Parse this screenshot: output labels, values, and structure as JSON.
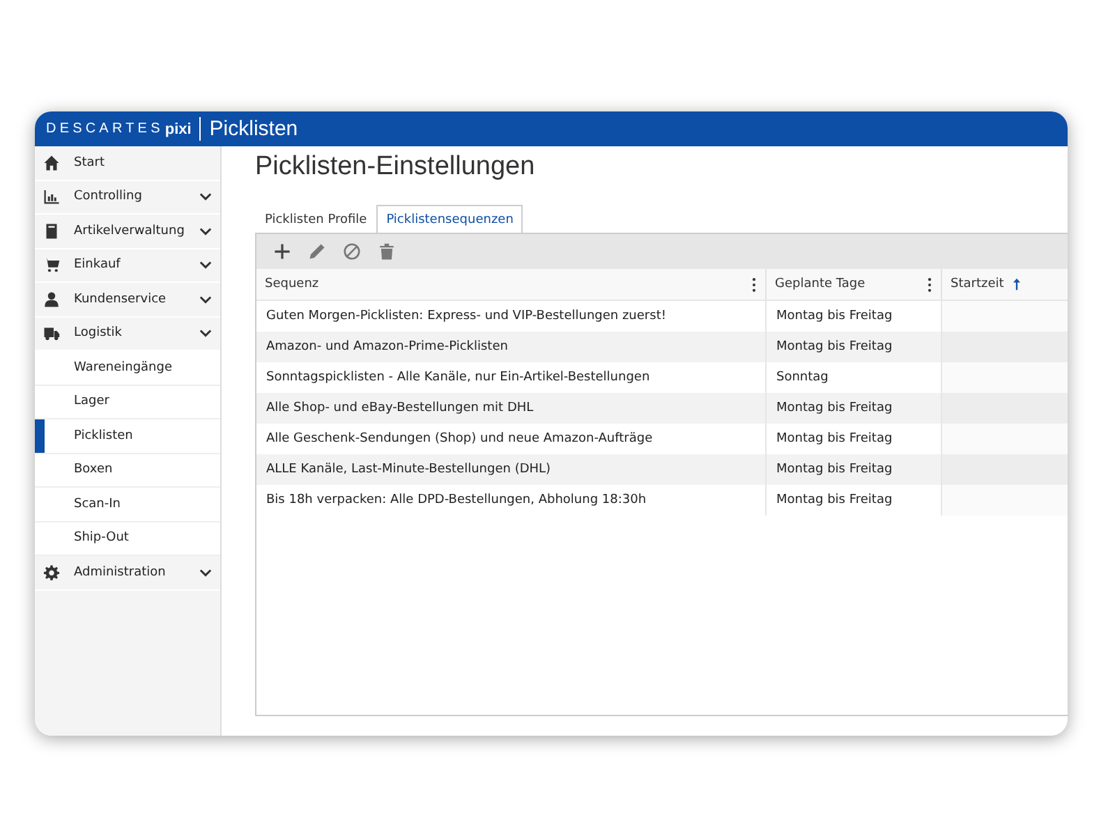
{
  "header": {
    "brand": "DESCARTES",
    "brand_product": "pixi",
    "app_title": "Picklisten"
  },
  "sidebar": {
    "items": [
      {
        "label": "Start",
        "kind": "link",
        "selected": false
      },
      {
        "label": "Controlling",
        "kind": "group",
        "selected": false
      },
      {
        "label": "Artikelverwaltung",
        "kind": "group",
        "selected": false
      },
      {
        "label": "Einkauf",
        "kind": "group",
        "selected": false
      },
      {
        "label": "Kundenservice",
        "kind": "group",
        "selected": false
      },
      {
        "label": "Logistik",
        "kind": "group",
        "selected": false,
        "children": [
          {
            "label": "Wareneingänge",
            "selected": false
          },
          {
            "label": "Lager",
            "selected": false
          },
          {
            "label": "Picklisten",
            "selected": true
          },
          {
            "label": "Boxen",
            "selected": false
          },
          {
            "label": "Scan-In",
            "selected": false
          },
          {
            "label": "Ship-Out",
            "selected": false
          }
        ]
      },
      {
        "label": "Administration",
        "kind": "group",
        "selected": false
      }
    ]
  },
  "page_title": "Picklisten-Einstellungen",
  "tabs": [
    {
      "label": "Picklisten Profile",
      "selected": false
    },
    {
      "label": "Picklistensequenzen",
      "selected": true
    }
  ],
  "table": {
    "columns": [
      {
        "label": "Sequenz",
        "menu": true,
        "sorted": false
      },
      {
        "label": "Geplante Tage",
        "menu": true,
        "sorted": false
      },
      {
        "label": "Startzeit",
        "menu": false,
        "sorted": true
      }
    ],
    "rows": [
      [
        "Guten Morgen-Picklisten: Express- und VIP-Bestellungen zuerst!",
        "Montag bis Freitag"
      ],
      [
        "Amazon- und Amazon-Prime-Picklisten",
        "Montag bis Freitag"
      ],
      [
        "Sonntagspicklisten - Alle Kanäle, nur Ein-Artikel-Bestellungen",
        "Sonntag"
      ],
      [
        "Alle Shop- und eBay-Bestellungen mit DHL",
        "Montag bis Freitag"
      ],
      [
        "Alle Geschenk-Sendungen (Shop) und neue Amazon-Aufträge",
        "Montag bis Freitag"
      ],
      [
        "ALLE Kanäle, Last-Minute-Bestellungen (DHL)",
        "Montag bis Freitag"
      ],
      [
        "Bis 18h verpacken: Alle DPD-Bestellungen, Abholung 18:30h",
        "Montag bis Freitag"
      ]
    ]
  }
}
